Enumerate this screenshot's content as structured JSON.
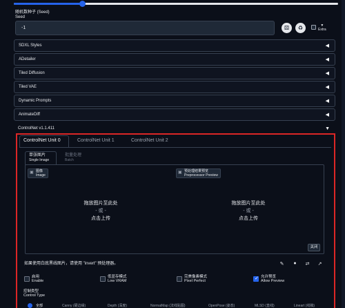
{
  "seed": {
    "label_cn": "随机数种子 (Seed)",
    "label_en": "Seed",
    "value": "-1",
    "extra_label": "Extra"
  },
  "icons": {
    "dice": "dice-icon",
    "recycle": "recycle-icon",
    "extra_toggle": "triangle-down-icon",
    "collapse_arrow": "triangle-left-icon",
    "expand_arrow": "triangle-down-icon"
  },
  "accordions": [
    {
      "label": "SDXL Styles"
    },
    {
      "label": "ADetailer"
    },
    {
      "label": "Tiled Diffusion"
    },
    {
      "label": "Tiled VAE"
    },
    {
      "label": "Dynamic Prompts"
    },
    {
      "label": "AnimateDiff"
    }
  ],
  "controlnet": {
    "header": "ControlNet v1.1.411",
    "units": [
      "ControlNet Unit 0",
      "ControlNet Unit 1",
      "ControlNet Unit 2"
    ],
    "subtabs": [
      {
        "cn": "单张图片",
        "en": "Single Image"
      },
      {
        "cn": "批量处理",
        "en": "Batch"
      }
    ],
    "image_tag": {
      "cn": "图像",
      "en": "Image"
    },
    "preview_tag": {
      "cn": "预处理结果预览",
      "en": "Preprocessor Preview"
    },
    "drop_text": {
      "line1": "拖放图片至此处",
      "line2": "- 或 -",
      "line3": "点击上传"
    },
    "close_label": "关闭",
    "hint": "如果使用白底黑线图片，请使用 \"invert\" 预处理器。",
    "checkboxes": [
      {
        "cn": "启用",
        "en": "Enable",
        "checked": false
      },
      {
        "cn": "低显存模式",
        "en": "Low VRAM",
        "checked": false
      },
      {
        "cn": "完美像素模式",
        "en": "Pixel Perfect",
        "checked": false
      },
      {
        "cn": "允许预览",
        "en": "Allow Preview",
        "checked": true
      }
    ],
    "control_type": {
      "label_cn": "控制类型",
      "label_en": "Control Type",
      "options": [
        "全部",
        "Canny (硬边缘)",
        "Depth (深度)",
        "NormalMap (法线贴图)",
        "OpenPose (姿态)",
        "MLSD (直线)",
        "Lineart (线稿)"
      ]
    }
  },
  "colors": {
    "accent": "#2563eb",
    "highlight_border": "#dc2626",
    "background": "#0b0f19"
  }
}
